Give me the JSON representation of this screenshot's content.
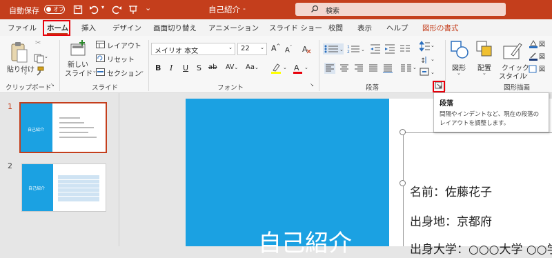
{
  "titlebar": {
    "autosave_label": "自動保存",
    "autosave_state": "オフ",
    "doc_title": "自己紹介",
    "separator": "-",
    "search_placeholder": "検索"
  },
  "tabs": [
    "ファイル",
    "ホーム",
    "挿入",
    "デザイン",
    "画面切り替え",
    "アニメーション",
    "スライド ショー",
    "校閲",
    "表示",
    "ヘルプ",
    "図形の書式"
  ],
  "ribbon": {
    "clipboard": {
      "paste_label": "貼り付け",
      "group": "クリップボード"
    },
    "slides": {
      "new_slide_1": "新しい",
      "new_slide_2": "スライド",
      "layout": "レイアウト",
      "reset": "リセット",
      "section": "セクション",
      "group": "スライド"
    },
    "font": {
      "font_name": "メイリオ 本文",
      "font_size": "22",
      "bold": "B",
      "italic": "I",
      "underline": "U",
      "shadow": "S",
      "strike": "ab",
      "spacing": "AV",
      "case": "Aa",
      "grow": "A",
      "shrink": "A",
      "group": "フォント"
    },
    "paragraph": {
      "group": "段落"
    },
    "drawing": {
      "shape": "図形",
      "arrange": "配置",
      "quick_style_1": "クイック",
      "quick_style_2": "スタイル",
      "group": "図形描画"
    }
  },
  "tooltip": {
    "title": "段落",
    "body_1": "間隔やインデントなど、現在の段落の",
    "body_2": "レイアウトを調整します。"
  },
  "thumbnails": [
    {
      "num": "1",
      "title": "自己紹介"
    },
    {
      "num": "2",
      "title": "自己紹介"
    }
  ],
  "slide": {
    "title": "自己紹介",
    "line1": "名前：佐藤花子",
    "line2": "出身地：京都府",
    "line3": "出身大学：○○○大学 ○○学部"
  },
  "colors": {
    "accent": "#c43e1c",
    "slide_blue": "#1ba1e2",
    "highlight": "#e8000b"
  }
}
